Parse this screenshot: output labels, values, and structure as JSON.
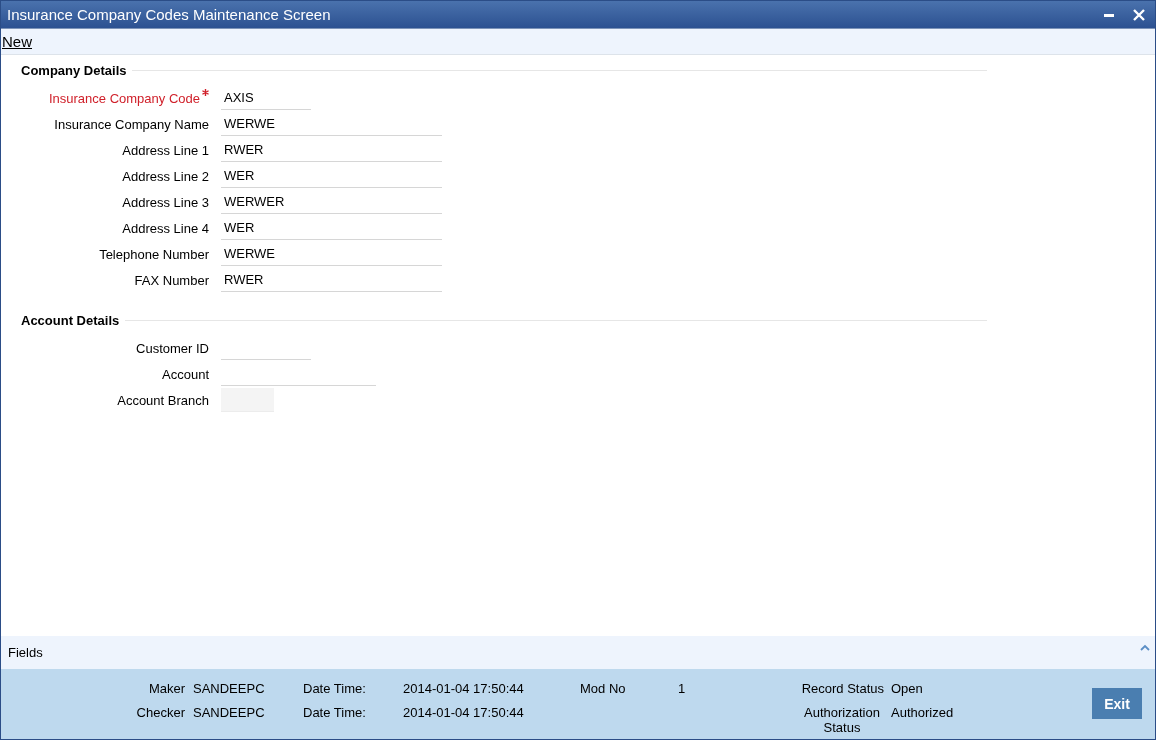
{
  "window": {
    "title": "Insurance Company Codes Maintenance Screen"
  },
  "toolbar": {
    "new_link": "New"
  },
  "sections": [
    {
      "title": "Company Details",
      "fields": [
        {
          "label": "Insurance Company Code",
          "value": "AXIS",
          "required": true,
          "disabled": false
        },
        {
          "label": "Insurance Company Name",
          "value": "WERWE",
          "required": false,
          "disabled": false
        },
        {
          "label": "Address Line 1",
          "value": "RWER",
          "required": false,
          "disabled": false
        },
        {
          "label": "Address Line 2",
          "value": "WER",
          "required": false,
          "disabled": false
        },
        {
          "label": "Address Line 3",
          "value": "WERWER",
          "required": false,
          "disabled": false
        },
        {
          "label": "Address Line 4",
          "value": "WER",
          "required": false,
          "disabled": false
        },
        {
          "label": "Telephone Number",
          "value": "WERWE",
          "required": false,
          "disabled": false
        },
        {
          "label": "FAX Number",
          "value": "RWER",
          "required": false,
          "disabled": false
        }
      ]
    },
    {
      "title": "Account Details",
      "fields": [
        {
          "label": "Customer ID",
          "required": false,
          "disabled": false
        },
        {
          "label": "Account",
          "required": false,
          "disabled": false
        },
        {
          "label": "Account Branch",
          "required": false,
          "disabled": true
        }
      ]
    }
  ],
  "fields_bar": {
    "label": "Fields"
  },
  "audit": {
    "rows": [
      {
        "role_label": "Maker",
        "user": "SANDEEPC",
        "date_label": "Date Time:",
        "date": "2014-01-04 17:50:44",
        "extra_label": "Mod No",
        "extra_value": "1",
        "status_label": "Record Status",
        "status": "Open"
      },
      {
        "role_label": "Checker",
        "user": "SANDEEPC",
        "date_label": "Date Time:",
        "date": "2014-01-04 17:50:44",
        "status_label": "Authorization Status",
        "status": "Authorized"
      }
    ]
  },
  "buttons": [
    "Exit"
  ]
}
